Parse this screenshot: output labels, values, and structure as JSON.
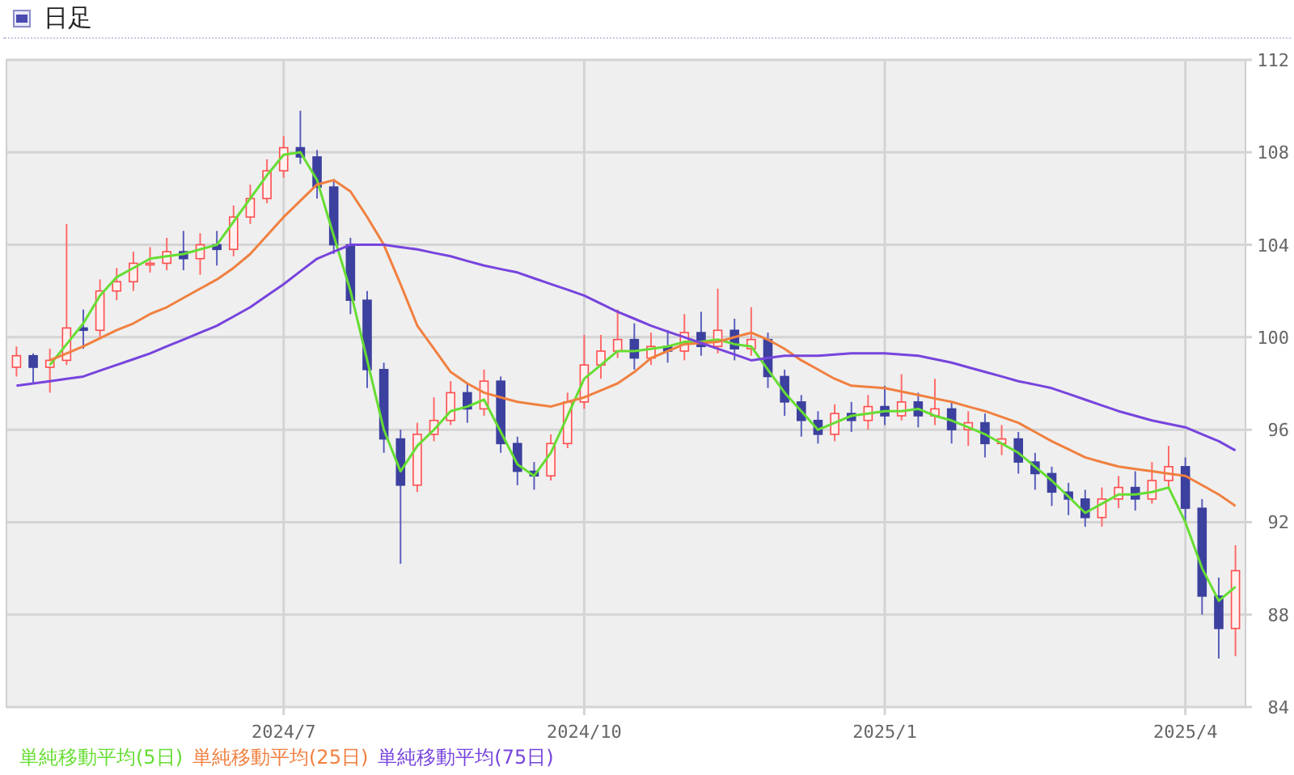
{
  "header": {
    "title": "日足"
  },
  "chart": {
    "chart_data": {
      "type": "candlestick",
      "grid": true,
      "ylim": [
        84,
        112
      ],
      "yticks": [
        84,
        88,
        92,
        96,
        100,
        104,
        108,
        112
      ],
      "categories": [
        null,
        null,
        null,
        null,
        null,
        null,
        null,
        null,
        null,
        null,
        null,
        null,
        null,
        null,
        null,
        null,
        "2024/7",
        null,
        null,
        null,
        null,
        null,
        null,
        null,
        null,
        null,
        null,
        null,
        null,
        null,
        null,
        null,
        null,
        null,
        "2024/10",
        null,
        null,
        null,
        null,
        null,
        null,
        null,
        null,
        null,
        null,
        null,
        null,
        null,
        null,
        null,
        null,
        null,
        "2025/1",
        null,
        null,
        null,
        null,
        null,
        null,
        null,
        null,
        null,
        null,
        null,
        null,
        null,
        null,
        null,
        null,
        null,
        "2025/4",
        null,
        null,
        null
      ],
      "series": [
        {
          "type": "candlestick",
          "ohlc": [
            [
              98.7,
              99.6,
              98.3,
              99.2
            ],
            [
              99.2,
              99.3,
              98.0,
              98.7
            ],
            [
              98.7,
              99.5,
              97.6,
              99.0
            ],
            [
              99.0,
              104.9,
              98.8,
              100.4
            ],
            [
              100.4,
              101.2,
              99.5,
              100.3
            ],
            [
              100.3,
              102.5,
              100.0,
              102.0
            ],
            [
              102.0,
              103.0,
              101.6,
              102.4
            ],
            [
              102.4,
              103.7,
              102.0,
              103.2
            ],
            [
              103.2,
              103.9,
              102.8,
              103.2
            ],
            [
              103.2,
              104.3,
              102.9,
              103.7
            ],
            [
              103.7,
              104.6,
              102.9,
              103.4
            ],
            [
              103.4,
              104.5,
              102.7,
              104.0
            ],
            [
              104.0,
              104.6,
              103.1,
              103.8
            ],
            [
              103.8,
              105.7,
              103.5,
              105.2
            ],
            [
              105.2,
              106.6,
              104.9,
              106.0
            ],
            [
              106.0,
              107.7,
              105.8,
              107.2
            ],
            [
              107.2,
              108.7,
              106.9,
              108.2
            ],
            [
              108.2,
              109.8,
              107.5,
              107.8
            ],
            [
              107.8,
              108.1,
              106.0,
              106.5
            ],
            [
              106.5,
              106.8,
              103.6,
              104.0
            ],
            [
              104.0,
              104.3,
              101.0,
              101.6
            ],
            [
              101.6,
              102.0,
              97.8,
              98.6
            ],
            [
              98.6,
              98.9,
              95.0,
              95.6
            ],
            [
              95.6,
              96.0,
              90.2,
              93.6
            ],
            [
              93.6,
              96.3,
              93.3,
              95.8
            ],
            [
              95.8,
              97.4,
              95.5,
              96.4
            ],
            [
              96.4,
              98.1,
              96.2,
              97.6
            ],
            [
              97.6,
              98.0,
              96.3,
              96.9
            ],
            [
              96.9,
              98.6,
              96.6,
              98.1
            ],
            [
              98.1,
              98.3,
              95.0,
              95.4
            ],
            [
              95.4,
              95.7,
              93.6,
              94.2
            ],
            [
              94.2,
              94.6,
              93.4,
              94.0
            ],
            [
              94.0,
              95.8,
              93.8,
              95.4
            ],
            [
              95.4,
              97.6,
              95.2,
              97.2
            ],
            [
              97.2,
              100.1,
              96.9,
              98.8
            ],
            [
              98.8,
              100.1,
              98.2,
              99.4
            ],
            [
              99.4,
              101.2,
              99.1,
              99.9
            ],
            [
              99.9,
              100.6,
              98.6,
              99.1
            ],
            [
              99.1,
              100.2,
              98.8,
              99.6
            ],
            [
              99.6,
              100.3,
              98.9,
              99.4
            ],
            [
              99.4,
              101.0,
              99.0,
              100.2
            ],
            [
              100.2,
              101.1,
              99.2,
              99.6
            ],
            [
              99.6,
              102.1,
              99.3,
              100.3
            ],
            [
              100.3,
              100.8,
              99.0,
              99.5
            ],
            [
              99.5,
              101.3,
              99.2,
              99.9
            ],
            [
              99.9,
              100.2,
              97.8,
              98.3
            ],
            [
              98.3,
              98.6,
              96.6,
              97.2
            ],
            [
              97.2,
              97.5,
              95.7,
              96.4
            ],
            [
              96.4,
              96.8,
              95.4,
              95.8
            ],
            [
              95.8,
              97.1,
              95.5,
              96.7
            ],
            [
              96.7,
              97.2,
              95.9,
              96.4
            ],
            [
              96.4,
              97.5,
              96.0,
              97.0
            ],
            [
              97.0,
              97.9,
              96.2,
              96.6
            ],
            [
              96.6,
              98.4,
              96.4,
              97.2
            ],
            [
              97.2,
              97.6,
              96.1,
              96.6
            ],
            [
              96.6,
              98.2,
              96.2,
              96.9
            ],
            [
              96.9,
              97.2,
              95.4,
              96.0
            ],
            [
              96.0,
              96.8,
              95.3,
              96.3
            ],
            [
              96.3,
              96.7,
              94.8,
              95.4
            ],
            [
              95.4,
              96.2,
              94.9,
              95.6
            ],
            [
              95.6,
              95.9,
              94.1,
              94.6
            ],
            [
              94.6,
              95.0,
              93.4,
              94.1
            ],
            [
              94.1,
              94.4,
              92.7,
              93.3
            ],
            [
              93.3,
              93.7,
              92.3,
              93.0
            ],
            [
              93.0,
              93.4,
              91.8,
              92.2
            ],
            [
              92.2,
              93.5,
              91.8,
              93.0
            ],
            [
              93.0,
              94.0,
              92.6,
              93.5
            ],
            [
              93.5,
              94.2,
              92.5,
              93.0
            ],
            [
              93.0,
              94.6,
              92.8,
              93.8
            ],
            [
              93.8,
              95.3,
              93.5,
              94.4
            ],
            [
              94.4,
              94.8,
              92.0,
              92.6
            ],
            [
              92.6,
              93.0,
              88.0,
              88.8
            ],
            [
              88.8,
              89.6,
              86.1,
              87.4
            ],
            [
              87.4,
              91.0,
              86.2,
              89.9
            ]
          ]
        },
        {
          "type": "line",
          "name": "単純移動平均(5日)",
          "color": "#66dd33",
          "values": [
            null,
            null,
            98.8,
            99.7,
            100.6,
            101.8,
            102.6,
            103.0,
            103.4,
            103.5,
            103.6,
            103.8,
            104.0,
            105.0,
            106.0,
            107.0,
            107.9,
            108.0,
            106.8,
            104.4,
            102.0,
            99.0,
            96.0,
            94.2,
            95.3,
            96.0,
            96.8,
            97.0,
            97.3,
            95.9,
            94.5,
            94.0,
            95.0,
            96.6,
            98.2,
            98.8,
            99.4,
            99.4,
            99.5,
            99.6,
            99.8,
            99.8,
            99.9,
            99.7,
            99.6,
            98.6,
            97.6,
            96.8,
            96.0,
            96.3,
            96.6,
            96.7,
            96.8,
            96.8,
            96.9,
            96.6,
            96.4,
            96.1,
            95.8,
            95.4,
            95.0,
            94.4,
            93.8,
            93.1,
            92.4,
            92.8,
            93.2,
            93.2,
            93.3,
            93.5,
            92.0,
            90.0,
            88.6,
            89.2
          ]
        },
        {
          "type": "line",
          "name": "単純移動平均(25日)",
          "color": "#f08040",
          "values": [
            null,
            null,
            99.0,
            99.3,
            99.6,
            99.95,
            100.3,
            100.6,
            101.0,
            101.3,
            101.7,
            102.1,
            102.5,
            103.0,
            103.6,
            104.4,
            105.2,
            105.9,
            106.6,
            106.8,
            106.3,
            105.2,
            104.0,
            102.3,
            100.5,
            99.5,
            98.5,
            98.0,
            97.6,
            97.4,
            97.2,
            97.1,
            97.0,
            97.2,
            97.4,
            97.7,
            98.0,
            98.5,
            99.1,
            99.4,
            99.7,
            99.75,
            99.8,
            100.0,
            100.2,
            99.9,
            99.5,
            99.0,
            98.6,
            98.2,
            97.9,
            97.85,
            97.8,
            97.65,
            97.5,
            97.35,
            97.2,
            97.0,
            96.8,
            96.55,
            96.3,
            95.9,
            95.5,
            95.15,
            94.8,
            94.6,
            94.4,
            94.3,
            94.2,
            94.1,
            94.0,
            93.6,
            93.2,
            92.7
          ]
        },
        {
          "type": "line",
          "name": "単純移動平均(75日)",
          "color": "#7744dd",
          "values": [
            97.9,
            98.0,
            98.1,
            98.2,
            98.3,
            98.55,
            98.8,
            99.05,
            99.3,
            99.6,
            99.9,
            100.2,
            100.5,
            100.9,
            101.3,
            101.8,
            102.3,
            102.85,
            103.4,
            103.7,
            104.0,
            104.0,
            104.0,
            103.9,
            103.8,
            103.65,
            103.5,
            103.3,
            103.1,
            102.95,
            102.8,
            102.55,
            102.3,
            102.05,
            101.8,
            101.45,
            101.1,
            100.8,
            100.5,
            100.25,
            100.0,
            99.75,
            99.5,
            99.25,
            99.0,
            99.1,
            99.2,
            99.2,
            99.2,
            99.25,
            99.3,
            99.3,
            99.3,
            99.25,
            99.2,
            99.05,
            98.9,
            98.7,
            98.5,
            98.3,
            98.1,
            97.95,
            97.8,
            97.55,
            97.3,
            97.05,
            96.8,
            96.6,
            96.4,
            96.25,
            96.1,
            95.8,
            95.5,
            95.1
          ]
        }
      ]
    }
  }
}
